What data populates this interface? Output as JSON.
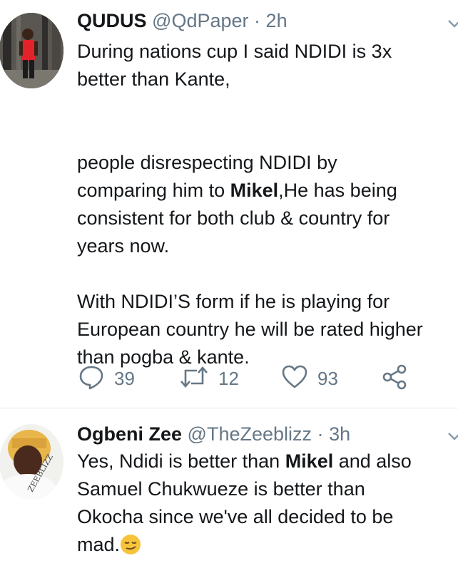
{
  "tweets": [
    {
      "name": "QUDUS",
      "handle": "@QdPaper",
      "separator": "·",
      "time": "2h",
      "text_parts": [
        "During nations cup I said NDIDI is 3x\nbetter than Kante,\n\n\npeople disrespecting NDIDI by\ncomparing him to ",
        "Mikel",
        ",He has being\nconsistent for both club & country for\nyears now.\n\nWith NDIDI’S form if he is playing for\nEuropean country he will be rated higher\nthan pogba & kante."
      ],
      "replies": "39",
      "retweets": "12",
      "likes": "93"
    },
    {
      "name": "Ogbeni Zee",
      "handle": "@TheZeeblizz",
      "separator": "·",
      "time": "3h",
      "text_parts": [
        "Yes, Ndidi is better than ",
        "Mikel",
        " and also\nSamuel Chukwueze is better than\nOkocha since we've all decided to be\nmad."
      ],
      "avatar_text": "ZEEBLIZZ"
    }
  ],
  "colors": {
    "text": "#14171a",
    "secondary": "#657786",
    "divider": "#e1e8ed"
  },
  "icons": [
    "caret-down-icon",
    "reply-icon",
    "retweet-icon",
    "like-icon",
    "share-icon",
    "smirk-emoji-icon"
  ]
}
